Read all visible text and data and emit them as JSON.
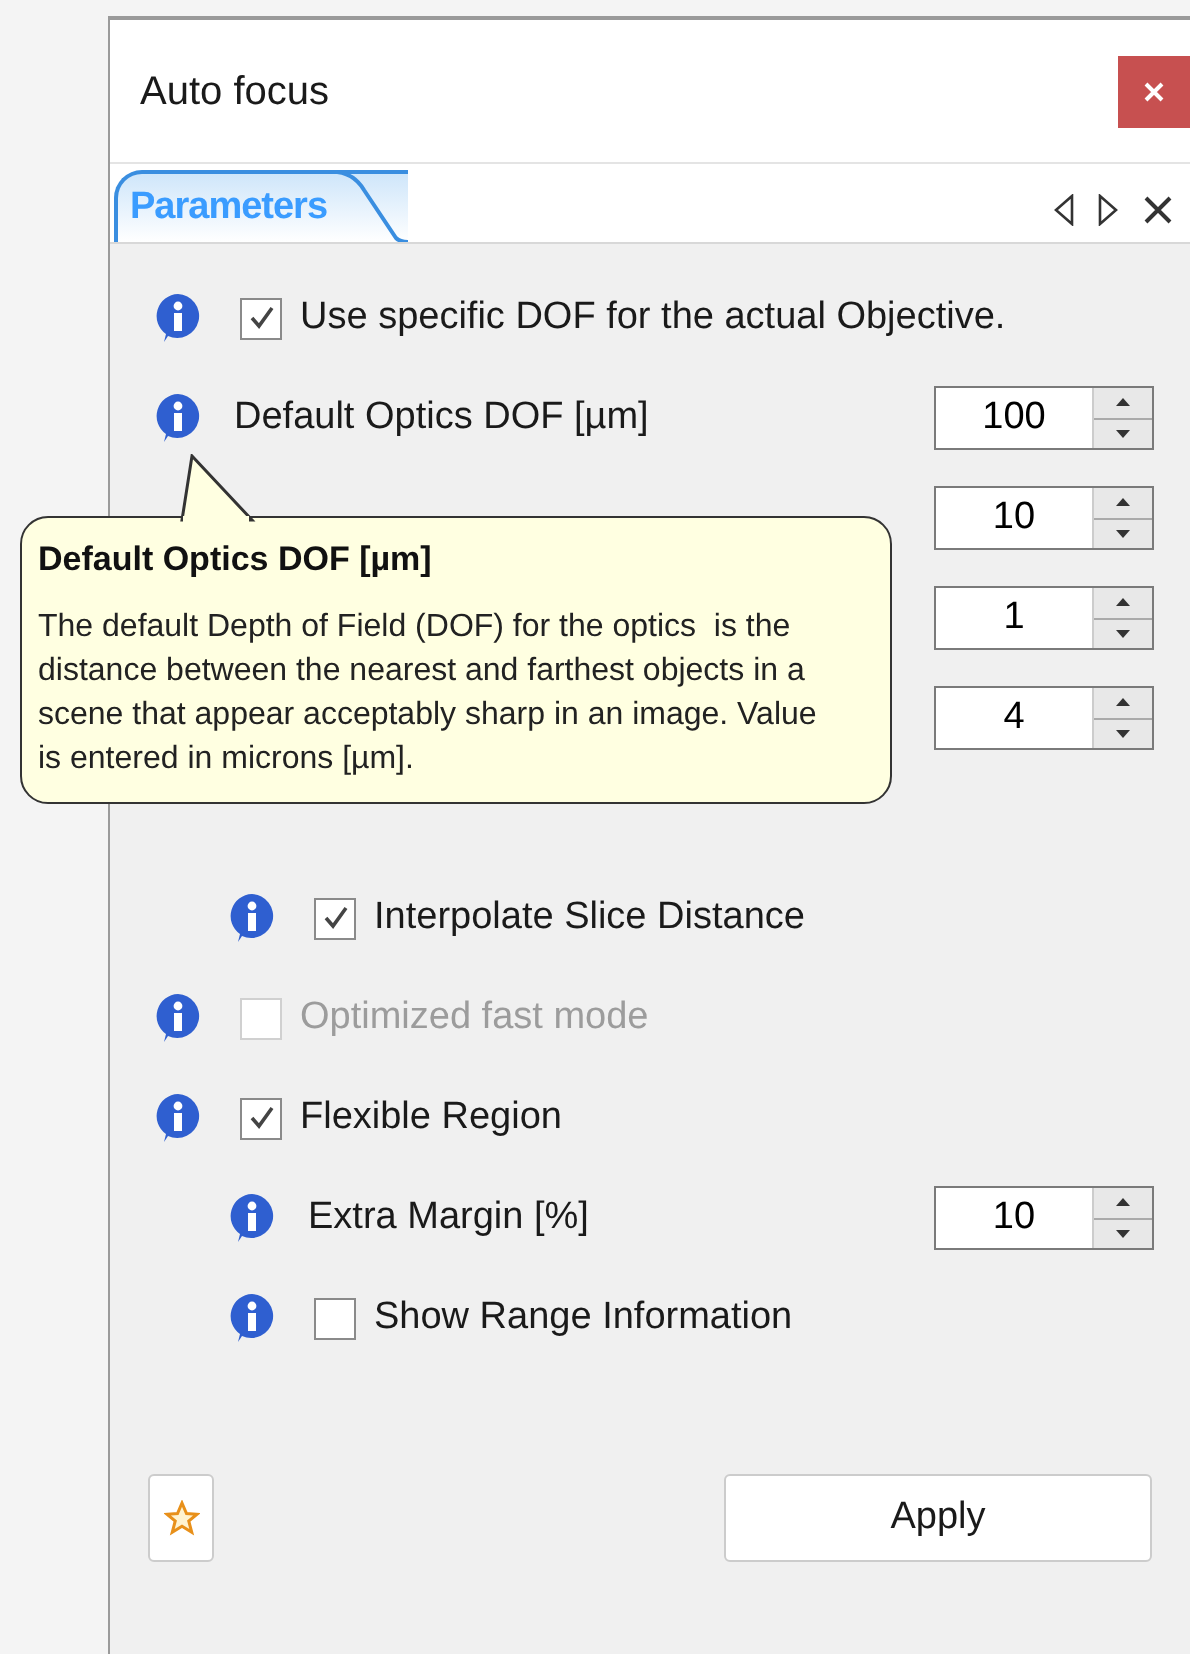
{
  "window": {
    "title": "Auto focus"
  },
  "tabs": [
    {
      "label": "Parameters",
      "selected": true
    }
  ],
  "parameters": [
    {
      "kind": "checkbox",
      "label": "Use specific DOF for the actual Objective.",
      "checked": true,
      "disabled": false
    },
    {
      "kind": "spin",
      "label": "Default Optics DOF [µm]",
      "value": "100"
    },
    {
      "kind": "spin",
      "value": "10"
    },
    {
      "kind": "spin",
      "value": "1"
    },
    {
      "kind": "spin",
      "value": "4",
      "children": [
        {
          "kind": "checkbox",
          "label": "Interpolate Slice Distance",
          "checked": true,
          "disabled": false
        }
      ]
    },
    {
      "kind": "checkbox",
      "label": "Optimized fast mode",
      "checked": false,
      "disabled": true
    },
    {
      "kind": "checkbox",
      "label": "Flexible Region",
      "checked": true,
      "disabled": false,
      "children": [
        {
          "kind": "spin",
          "label": "Extra Margin [%]",
          "value": "10"
        },
        {
          "kind": "checkbox",
          "label": "Show Range Information",
          "checked": false,
          "disabled": false
        }
      ]
    }
  ],
  "tooltip": {
    "title": "Default Optics DOF [µm]",
    "text": "The default Depth of Field (DOF) for the optics  is the distance between the nearest and farthest objects in a scene that appear acceptably sharp in an image. Value is entered in microns [µm]."
  },
  "buttons": [
    {
      "kind": "favorite"
    },
    {
      "kind": "text",
      "label": "Apply"
    }
  ]
}
